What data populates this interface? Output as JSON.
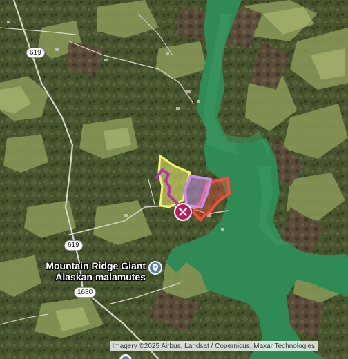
{
  "map": {
    "type": "satellite",
    "road_labels": [
      {
        "id": "619-north",
        "text": "619"
      },
      {
        "id": "619-south",
        "text": "619"
      },
      {
        "id": "1680",
        "text": "1680"
      }
    ],
    "poi": {
      "name_line1": "Mountain Ridge Giant",
      "name_line2": "Alaskan malamutes",
      "icon": "map-pin-icon"
    },
    "overlays": [
      {
        "name": "yellow-parcel",
        "color": "#f3f36b"
      },
      {
        "name": "purple-parcel",
        "color": "#c78ee6"
      },
      {
        "name": "red-parcel",
        "color": "#ff4a3d"
      },
      {
        "name": "magenta-path",
        "color": "#b630b8"
      }
    ],
    "remove_marker": {
      "icon": "close-circle-icon",
      "color": "#c2185b"
    },
    "attribution": "Imagery ©2025 Airbus, Landsat / Copernicus, Maxar Technologies"
  }
}
